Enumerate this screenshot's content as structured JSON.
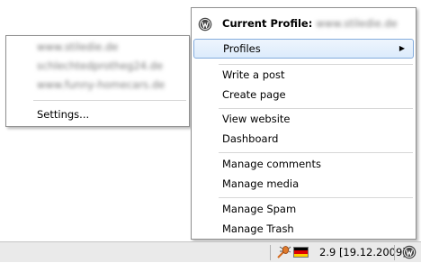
{
  "main_menu": {
    "header_label": "Current Profile:",
    "header_value": "www.stiledie.de",
    "profiles_label": "Profiles",
    "items": [
      "Write a post",
      "Create page",
      "View website",
      "Dashboard",
      "Manage comments",
      "Manage media",
      "Manage Spam",
      "Manage Trash"
    ]
  },
  "sub_menu": {
    "profiles": [
      "www.stiledie.de",
      "schlechtedprotheg24.de",
      "www.funny-homecars.de"
    ],
    "settings_label": "Settings..."
  },
  "taskbar": {
    "version_text": "2.9 [19.12.2009]"
  },
  "icons": {
    "wordpress": "wordpress-logo-icon",
    "submenu_arrow": "arrow-right-icon",
    "bug": "bug-icon",
    "flag": "german-flag-icon"
  },
  "colors": {
    "highlight_fill": "#dcebfc",
    "highlight_border": "#84acdd",
    "menu_border": "#8f8f8f",
    "taskbar": "#eaeaea",
    "flag": [
      "#000000",
      "#dd0000",
      "#ffce00"
    ]
  }
}
